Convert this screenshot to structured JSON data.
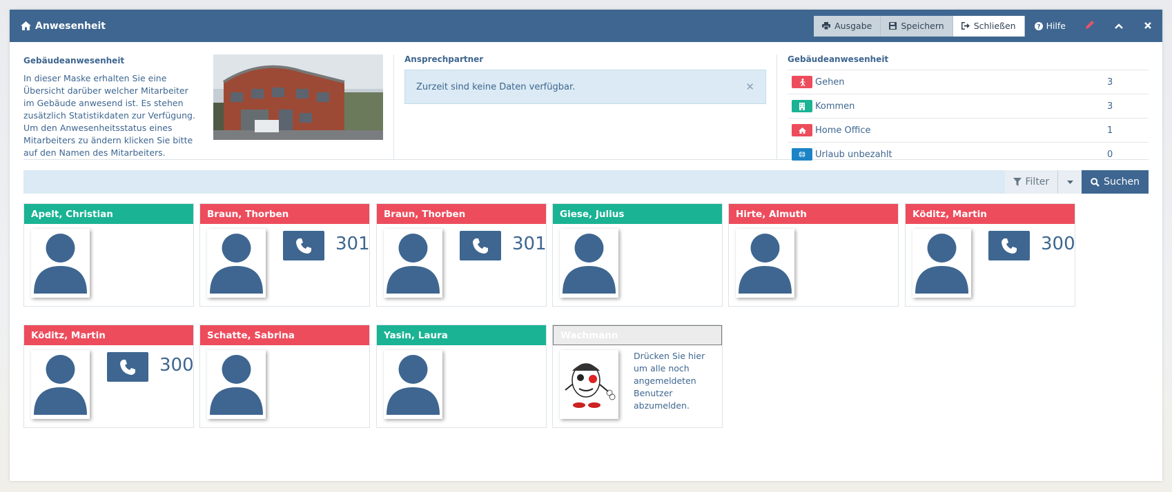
{
  "window": {
    "title": "Anwesenheit",
    "buttons": {
      "ausgabe": "Ausgabe",
      "speichern": "Speichern",
      "schliessen": "Schließen",
      "hilfe": "Hilfe"
    }
  },
  "intro": {
    "heading": "Gebäudeanwesenheit",
    "text": "In dieser Maske erhalten Sie eine Übersicht darüber welcher Mitarbeiter im Gebäude anwesend ist. Es stehen zusätzlich Statistikdaten zur Verfügung. Um den Anwesenheitsstatus eines Mitarbeiters zu ändern klicken Sie bitte auf den Namen des Mitarbeiters."
  },
  "contact": {
    "heading": "Ansprechpartner",
    "alert": "Zurzeit sind keine Daten verfügbar."
  },
  "stats": {
    "heading": "Gebäudeanwesenheit",
    "rows": [
      {
        "label": "Gehen",
        "count": "3",
        "color": "#ed4c5c",
        "icon": "running-icon"
      },
      {
        "label": "Kommen",
        "count": "3",
        "color": "#1ab394",
        "icon": "building-icon"
      },
      {
        "label": "Home Office",
        "count": "1",
        "color": "#ed4c5c",
        "icon": "home-icon"
      },
      {
        "label": "Urlaub unbezahlt",
        "count": "0",
        "color": "#1c84c6",
        "icon": "globe-icon"
      }
    ]
  },
  "search": {
    "filter": "Filter",
    "search": "Suchen"
  },
  "employees": [
    {
      "name": "Apelt, Christian",
      "status": "green"
    },
    {
      "name": "Braun, Thorben",
      "status": "red",
      "ext": "301"
    },
    {
      "name": "Braun, Thorben",
      "status": "red",
      "ext": "301"
    },
    {
      "name": "Giese, Julius",
      "status": "green"
    },
    {
      "name": "Hirte, Almuth",
      "status": "red"
    },
    {
      "name": "Köditz, Martin",
      "status": "red",
      "ext": "300"
    },
    {
      "name": "Köditz, Martin",
      "status": "red",
      "ext": "300"
    },
    {
      "name": "Schatte, Sabrina",
      "status": "red"
    },
    {
      "name": "Yasin, Laura",
      "status": "green"
    }
  ],
  "guard": {
    "name": "Wachmann",
    "text": "Drücken Sie hier um alle noch angemeldeten Benutzer abzumelden."
  }
}
